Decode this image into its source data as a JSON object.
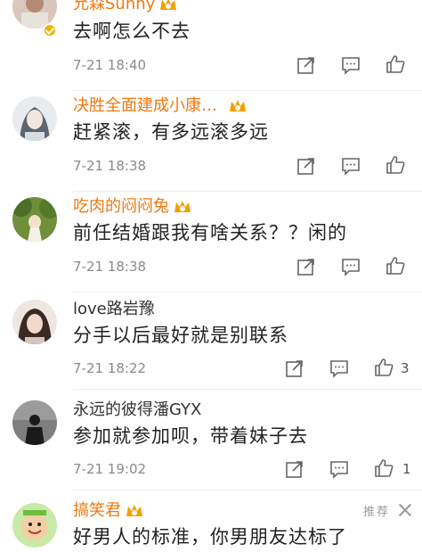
{
  "comments": [
    {
      "username": "允森Sunny",
      "text": "去啊怎么不去",
      "time": "7-21 18:40",
      "likes": "",
      "avatar_icon": "portrait-avatar-icon",
      "verified": true
    },
    {
      "username": "决胜全面建成小康…",
      "text": "赶紧滚，有多远滚多远",
      "time": "7-21 18:38",
      "likes": "",
      "avatar_icon": "anime-avatar-icon"
    },
    {
      "username": "吃肉的闷闷兔",
      "text": "前任结婚跟我有啥关系？？闲的",
      "time": "7-21 18:38",
      "likes": "",
      "avatar_icon": "forest-girl-avatar-icon"
    },
    {
      "username": "love路岩豫",
      "text": "分手以后最好就是别联系",
      "time": "7-21 18:22",
      "likes": "3",
      "avatar_icon": "selfie-avatar-icon"
    },
    {
      "username": "永远的彼得潘GYX",
      "text": "参加就参加呗，带着妹子去",
      "time": "7-21 19:02",
      "likes": "1",
      "avatar_icon": "silhouette-avatar-icon"
    },
    {
      "username": "搞笑君",
      "text": "好男人的标准，你男朋友达标了",
      "recommend_label": "推荐",
      "avatar_icon": "cartoon-face-avatar-icon"
    }
  ],
  "actions": {
    "share_icon": "share-icon",
    "reply_icon": "comment-icon",
    "like_icon": "thumbs-up-icon"
  },
  "colors": {
    "vip_name": "#f07810",
    "normal_name": "#333333",
    "time": "#8a8a8a",
    "divider": "#ececec"
  }
}
